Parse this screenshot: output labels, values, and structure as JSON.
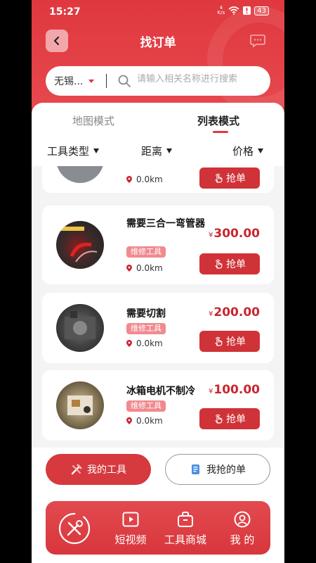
{
  "status_bar": {
    "time": "15:27",
    "net_speed_value": "4",
    "net_speed_unit": "K/s",
    "battery": "43"
  },
  "header": {
    "title": "找订单",
    "city": "无锡...",
    "search_placeholder": "请输入相关名称进行搜索"
  },
  "tabs": [
    {
      "label": "地图模式",
      "active": false
    },
    {
      "label": "列表模式",
      "active": true
    }
  ],
  "filters": [
    {
      "label": "工具类型"
    },
    {
      "label": "距离"
    },
    {
      "label": "价格"
    }
  ],
  "orders": [
    {
      "title": "",
      "tag": "",
      "distance": "0.0km",
      "price_symbol": "",
      "price": "",
      "button": "抢单"
    },
    {
      "title": "需要三合一弯管器",
      "tag": "维修工具",
      "distance": "0.0km",
      "price_symbol": "¥",
      "price": "300.00",
      "button": "抢单"
    },
    {
      "title": "需要切割",
      "tag": "维修工具",
      "distance": "0.0km",
      "price_symbol": "¥",
      "price": "200.00",
      "button": "抢单"
    },
    {
      "title": "冰箱电机不制冷",
      "tag": "维修工具",
      "distance": "0.0km",
      "price_symbol": "¥",
      "price": "100.00",
      "button": "抢单"
    }
  ],
  "actions": {
    "my_tools": "我的工具",
    "my_orders": "我抢的单"
  },
  "bottom_nav": [
    {
      "label": "短视频",
      "icon": "video-icon"
    },
    {
      "label": "工具商城",
      "icon": "bag-icon"
    },
    {
      "label": "我 的",
      "icon": "user-icon"
    }
  ],
  "colors": {
    "primary": "#e0383f",
    "button": "#cf3338",
    "tag": "#f08a8f",
    "price": "#c8262f"
  }
}
